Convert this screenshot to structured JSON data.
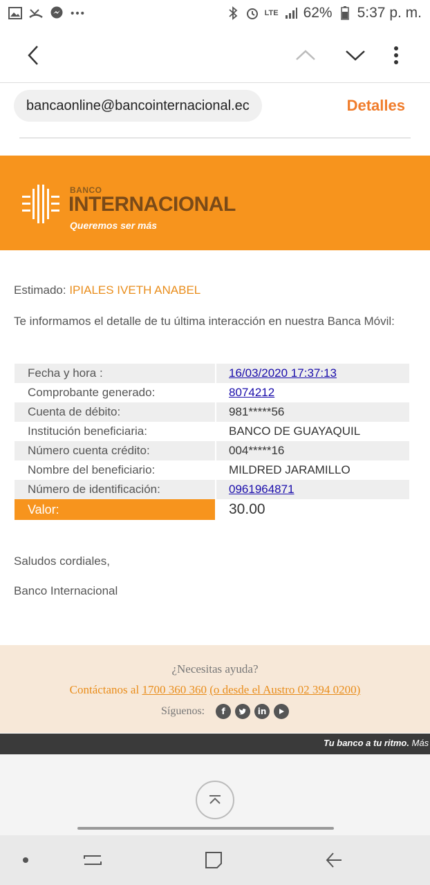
{
  "status_bar": {
    "battery": "62%",
    "time": "5:37 p. m.",
    "network": "LTE"
  },
  "toolbar": {
    "back_icon": "back-arrow-icon",
    "prev_icon": "chevron-up-icon",
    "next_icon": "chevron-down-icon",
    "menu_icon": "more-vert-icon"
  },
  "sender": {
    "email": "bancaonline@bancointernacional.ec",
    "details_label": "Detalles"
  },
  "banner": {
    "bank_small": "BANCO",
    "bank_name": "INTERNACIONAL",
    "tagline": "Queremos ser más",
    "color": "#f7941d"
  },
  "message": {
    "greeting_label": "Estimado:",
    "customer_name": "IPIALES IVETH ANABEL",
    "intro": "Te informamos el detalle de tu última interacción en nuestra Banca Móvil:"
  },
  "details": [
    {
      "label": "Fecha y hora :",
      "value": "16/03/2020 17:37:13"
    },
    {
      "label": "Comprobante generado:",
      "value": "8074212"
    },
    {
      "label": "Cuenta de débito:",
      "value": "981*****56"
    },
    {
      "label": "Institución beneficiaria:",
      "value": "BANCO DE GUAYAQUIL"
    },
    {
      "label": "Número cuenta crédito:",
      "value": "004*****16"
    },
    {
      "label": "Nombre del beneficiario:",
      "value": "MILDRED JARAMILLO"
    },
    {
      "label": "Número de identificación:",
      "value": "0961964871"
    }
  ],
  "total": {
    "label": "Valor:",
    "value": "30.00"
  },
  "closing": {
    "line1": "Saludos cordiales,",
    "line2": "Banco Internacional"
  },
  "help": {
    "title": "¿Necesitas ayuda?",
    "contact_prefix": "Contáctanos al",
    "phone": "1700 360 360",
    "contact_suffix": "(o desde el Austro 02 394 0200)",
    "follow_label": "Síguenos:"
  },
  "slogan": {
    "main": "Tu banco a tu ritmo.",
    "more": "Más có"
  }
}
